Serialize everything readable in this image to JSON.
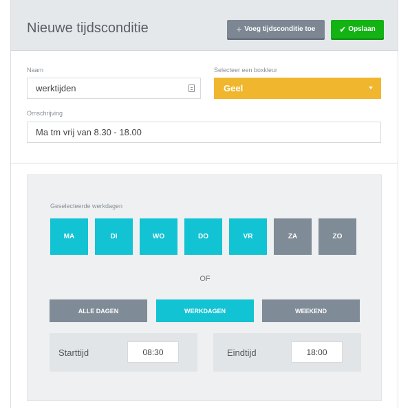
{
  "header": {
    "title": "Nieuwe tijdsconditie",
    "add_button": "Voeg tijdsconditie toe",
    "save_button": "Opslaan"
  },
  "form": {
    "name_label": "Naam",
    "name_value": "werktijden",
    "color_label": "Selecteer een boxkleur",
    "color_value": "Geel",
    "color_hex": "#f0b62e",
    "description_label": "Omschrijving",
    "description_value": "Ma tm vrij van 8.30 - 18.00"
  },
  "days": {
    "label": "Geselecteerde werkdagen",
    "items": [
      {
        "label": "MA",
        "selected": true
      },
      {
        "label": "DI",
        "selected": true
      },
      {
        "label": "WO",
        "selected": true
      },
      {
        "label": "DO",
        "selected": true
      },
      {
        "label": "VR",
        "selected": true
      },
      {
        "label": "ZA",
        "selected": false
      },
      {
        "label": "ZO",
        "selected": false
      }
    ],
    "or_text": "OF",
    "presets": [
      {
        "label": "ALLE DAGEN",
        "selected": false
      },
      {
        "label": "WERKDAGEN",
        "selected": true
      },
      {
        "label": "WEEKEND",
        "selected": false
      }
    ]
  },
  "times": {
    "start_label": "Starttijd",
    "start_value": "08:30",
    "end_label": "Eindtijd",
    "end_value": "18:00"
  },
  "colors": {
    "accent": "#12c3d3",
    "inactive": "#7f8b96",
    "save": "#13b314"
  }
}
